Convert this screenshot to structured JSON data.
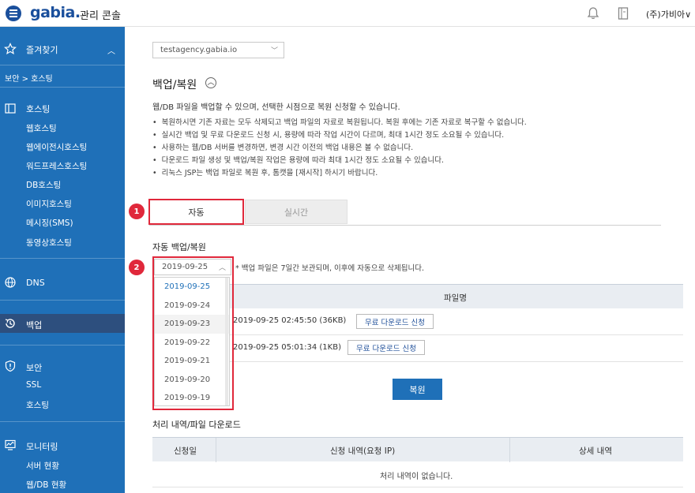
{
  "header": {
    "brand": "gabia.",
    "subtitle": "관리 콘솔",
    "account": "(주)가비아∨"
  },
  "sidebar": {
    "favorites": "즐겨찾기",
    "breadcrumb": "보안 > 호스팅",
    "hosting": {
      "label": "호스팅",
      "items": [
        "웹호스팅",
        "웹에이전시호스팅",
        "워드프레스호스팅",
        "DB호스팅",
        "이미지호스팅",
        "메시징(SMS)",
        "동영상호스팅"
      ]
    },
    "dns": "DNS",
    "backup": "백업",
    "security": {
      "label": "보안",
      "items": [
        "SSL",
        "호스팅"
      ]
    },
    "monitoring": {
      "label": "모니터링",
      "items": [
        "서버 현황",
        "웹/DB 현황"
      ]
    }
  },
  "main": {
    "domain": "testagency.gabia.io",
    "title": "백업/복원",
    "description": "웹/DB 파일을 백업할 수 있으며, 선택한 시점으로 복원 신청할 수 있습니다.",
    "notes": [
      "복원하시면 기존 자료는 모두 삭제되고 백업 파일의 자료로 복원됩니다. 복원 후에는 기존 자료로 복구할 수 없습니다.",
      "실시간 백업 및 무료 다운로드 신청 시, 용량에 따라 작업 시간이 다르며, 최대 1시간 정도 소요될 수 있습니다.",
      "사용하는 웹/DB 서버를 변경하면, 변경 시간 이전의 백업 내용은 볼 수 없습니다.",
      "다운로드 파일 생성 및 백업/복원 작업은 용량에 따라 최대 1시간 정도 소요될 수 있습니다.",
      "리눅스 JSP는 백업 파일로 복원 후, 톰캣을 [재시작] 하시기 바랍니다."
    ],
    "tabs": {
      "auto": "자동",
      "realtime": "실시간"
    },
    "steps": {
      "one": "1",
      "two": "2"
    },
    "section_title": "자동 백업/복원",
    "date_selected": "2019-09-25",
    "date_note": "* 백업 파일은 7일간 보관되며, 이후에 자동으로 삭제됩니다.",
    "date_options": [
      "2019-09-25",
      "2019-09-24",
      "2019-09-23",
      "2019-09-22",
      "2019-09-21",
      "2019-09-20",
      "2019-09-19"
    ],
    "file_header": "파일명",
    "files": [
      {
        "name": "2019-09-25 02:45:50 (36KB)",
        "action": "무료 다운로드 신청"
      },
      {
        "name": "2019-09-25 05:01:34 (1KB)",
        "action": "무료 다운로드 신청"
      }
    ],
    "restore": "복원",
    "history_title": "처리 내역/파일 다운로드",
    "history_headers": [
      "신청일",
      "신청 내역(요청 IP)",
      "상세 내역"
    ],
    "history_empty": "처리 내역이 없습니다."
  }
}
